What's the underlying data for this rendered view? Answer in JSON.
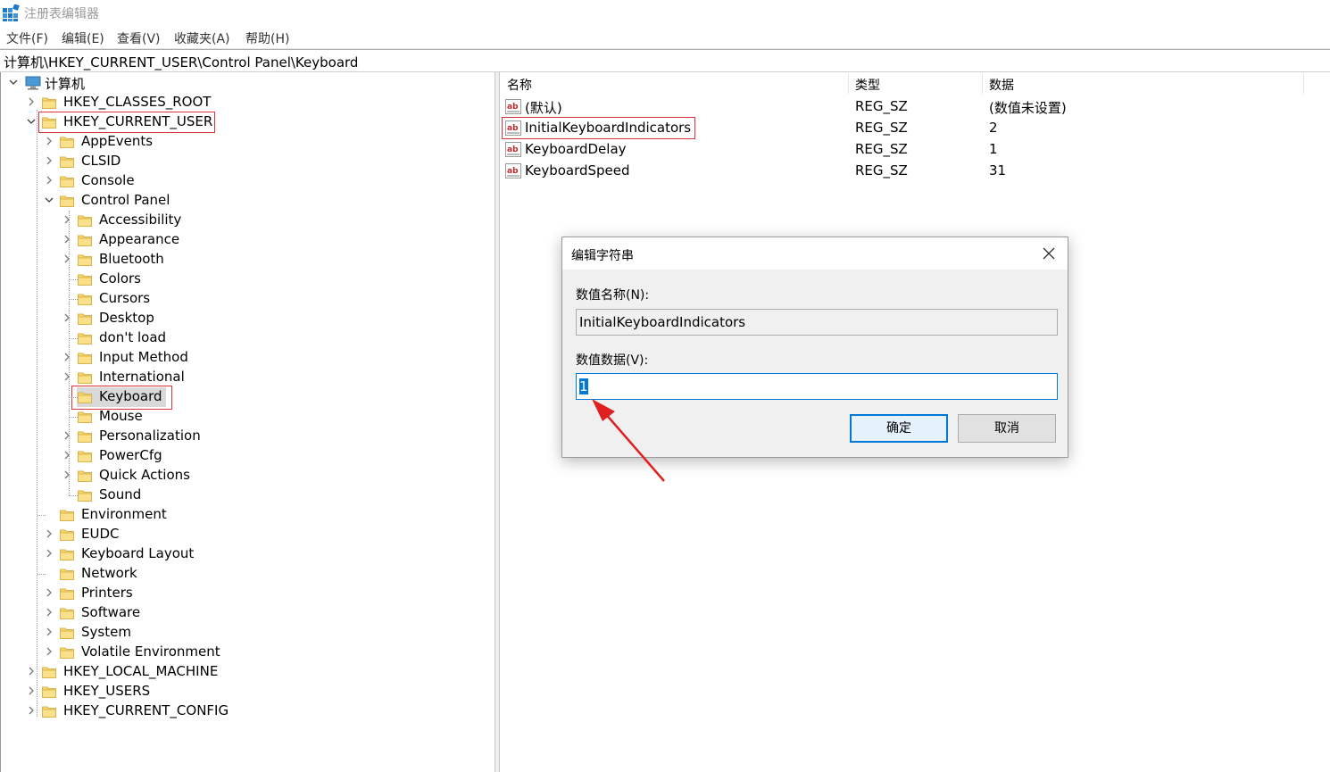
{
  "window": {
    "title": "注册表编辑器"
  },
  "menu": [
    "文件(F)",
    "编辑(E)",
    "查看(V)",
    "收藏夹(A)",
    "帮助(H)"
  ],
  "address": "计算机\\HKEY_CURRENT_USER\\Control Panel\\Keyboard",
  "tree": {
    "root": "计算机",
    "hives": {
      "classes_root": "HKEY_CLASSES_ROOT",
      "current_user": "HKEY_CURRENT_USER",
      "local_machine": "HKEY_LOCAL_MACHINE",
      "users": "HKEY_USERS",
      "current_config": "HKEY_CURRENT_CONFIG"
    },
    "hkcu_children": [
      "AppEvents",
      "CLSID",
      "Console",
      "Control Panel",
      "Environment",
      "EUDC",
      "Keyboard Layout",
      "Network",
      "Printers",
      "Software",
      "System",
      "Volatile Environment"
    ],
    "control_panel_children": [
      "Accessibility",
      "Appearance",
      "Bluetooth",
      "Colors",
      "Cursors",
      "Desktop",
      "don't load",
      "Input Method",
      "International",
      "Keyboard",
      "Mouse",
      "Personalization",
      "PowerCfg",
      "Quick Actions",
      "Sound"
    ],
    "selected": "Keyboard"
  },
  "list": {
    "headers": {
      "name": "名称",
      "type": "类型",
      "data": "数据"
    },
    "rows": [
      {
        "name": "(默认)",
        "type": "REG_SZ",
        "data": "(数值未设置)"
      },
      {
        "name": "InitialKeyboardIndicators",
        "type": "REG_SZ",
        "data": "2"
      },
      {
        "name": "KeyboardDelay",
        "type": "REG_SZ",
        "data": "1"
      },
      {
        "name": "KeyboardSpeed",
        "type": "REG_SZ",
        "data": "31"
      }
    ]
  },
  "dialog": {
    "title": "编辑字符串",
    "name_label": "数值名称(N):",
    "name_value": "InitialKeyboardIndicators",
    "data_label": "数值数据(V):",
    "data_value": "1",
    "ok": "确定",
    "cancel": "取消"
  },
  "colors": {
    "highlight_box": "#d9323a",
    "annotation_arrow": "#e02020",
    "focus_blue": "#0078d7",
    "folder": "#f7d66b"
  }
}
